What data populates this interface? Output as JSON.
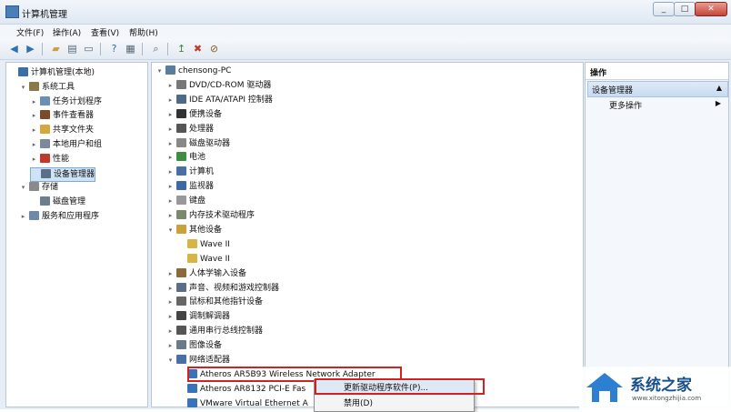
{
  "window": {
    "title": "计算机管理",
    "buttons": [
      "_",
      "□",
      "✕"
    ]
  },
  "menubar": [
    "文件(F)",
    "操作(A)",
    "查看(V)",
    "帮助(H)"
  ],
  "toolbar": [
    "back-icon",
    "forward-icon",
    "up-folder-icon",
    "console-tree-icon",
    "properties-icon",
    "help-icon",
    "pane-icon",
    "scan-icon",
    "update-driver-icon",
    "uninstall-icon",
    "disable-icon"
  ],
  "left_tree": [
    {
      "label": "计算机管理(本地)",
      "level": 0,
      "arrow": "",
      "icon": "#3b6ea5"
    },
    {
      "label": "系统工具",
      "level": 1,
      "arrow": "▾",
      "icon": "#8a7a4a"
    },
    {
      "label": "任务计划程序",
      "level": 2,
      "arrow": "▸",
      "icon": "#6a8fb3"
    },
    {
      "label": "事件查看器",
      "level": 2,
      "arrow": "▸",
      "icon": "#7a4a2a"
    },
    {
      "label": "共享文件夹",
      "level": 2,
      "arrow": "▸",
      "icon": "#d7a63d"
    },
    {
      "label": "本地用户和组",
      "level": 2,
      "arrow": "▸",
      "icon": "#7a8a9a"
    },
    {
      "label": "性能",
      "level": 2,
      "arrow": "▸",
      "icon": "#c0392b"
    },
    {
      "label": "设备管理器",
      "level": 2,
      "arrow": "",
      "icon": "#5a6e8a",
      "selected": true
    },
    {
      "label": "存储",
      "level": 1,
      "arrow": "▾",
      "icon": "#8a8a8a"
    },
    {
      "label": "磁盘管理",
      "level": 2,
      "arrow": "",
      "icon": "#6d7d8d"
    },
    {
      "label": "服务和应用程序",
      "level": 1,
      "arrow": "▸",
      "icon": "#6f8aa8"
    }
  ],
  "device_tree": [
    {
      "label": "chensong-PC",
      "level": 0,
      "arrow": "▾",
      "icon": "#5a7c9e"
    },
    {
      "label": "DVD/CD-ROM 驱动器",
      "level": 1,
      "arrow": "▸",
      "icon": "#777"
    },
    {
      "label": "IDE ATA/ATAPI 控制器",
      "level": 1,
      "arrow": "▸",
      "icon": "#4f6a86"
    },
    {
      "label": "便携设备",
      "level": 1,
      "arrow": "▸",
      "icon": "#333"
    },
    {
      "label": "处理器",
      "level": 1,
      "arrow": "▸",
      "icon": "#555"
    },
    {
      "label": "磁盘驱动器",
      "level": 1,
      "arrow": "▸",
      "icon": "#888"
    },
    {
      "label": "电池",
      "level": 1,
      "arrow": "▸",
      "icon": "#3e8e41"
    },
    {
      "label": "计算机",
      "level": 1,
      "arrow": "▸",
      "icon": "#4a6fa5"
    },
    {
      "label": "监视器",
      "level": 1,
      "arrow": "▸",
      "icon": "#3d6aa2"
    },
    {
      "label": "键盘",
      "level": 1,
      "arrow": "▸",
      "icon": "#999"
    },
    {
      "label": "内存技术驱动程序",
      "level": 1,
      "arrow": "▸",
      "icon": "#7a8a6a"
    },
    {
      "label": "其他设备",
      "level": 1,
      "arrow": "▾",
      "icon": "#c9a33a"
    },
    {
      "label": "Wave II",
      "level": 2,
      "arrow": "",
      "icon": "#d8b447"
    },
    {
      "label": "Wave II",
      "level": 2,
      "arrow": "",
      "icon": "#d8b447"
    },
    {
      "label": "人体学输入设备",
      "level": 1,
      "arrow": "▸",
      "icon": "#8c6a3a"
    },
    {
      "label": "声音、视频和游戏控制器",
      "level": 1,
      "arrow": "▸",
      "icon": "#5a6e8a"
    },
    {
      "label": "鼠标和其他指针设备",
      "level": 1,
      "arrow": "▸",
      "icon": "#666"
    },
    {
      "label": "调制解调器",
      "level": 1,
      "arrow": "▸",
      "icon": "#444"
    },
    {
      "label": "通用串行总线控制器",
      "level": 1,
      "arrow": "▸",
      "icon": "#555"
    },
    {
      "label": "图像设备",
      "level": 1,
      "arrow": "▸",
      "icon": "#6a7a8a"
    },
    {
      "label": "网络适配器",
      "level": 1,
      "arrow": "▾",
      "icon": "#4a6fa5"
    },
    {
      "label": "Atheros AR5B93 Wireless Network Adapter",
      "level": 2,
      "arrow": "",
      "icon": "#3b73b9"
    },
    {
      "label": "Atheros AR8132 PCI-E Fas",
      "level": 2,
      "arrow": "",
      "icon": "#3b73b9"
    },
    {
      "label": "VMware Virtual Ethernet A",
      "level": 2,
      "arrow": "",
      "icon": "#3b73b9"
    }
  ],
  "actions": {
    "header": "操作",
    "selected": "设备管理器",
    "more": "更多操作"
  },
  "context_menu": [
    "更新驱动程序软件(P)...",
    "禁用(D)"
  ],
  "watermark": {
    "name": "系统之家",
    "url": "www.xitongzhijia.com"
  }
}
